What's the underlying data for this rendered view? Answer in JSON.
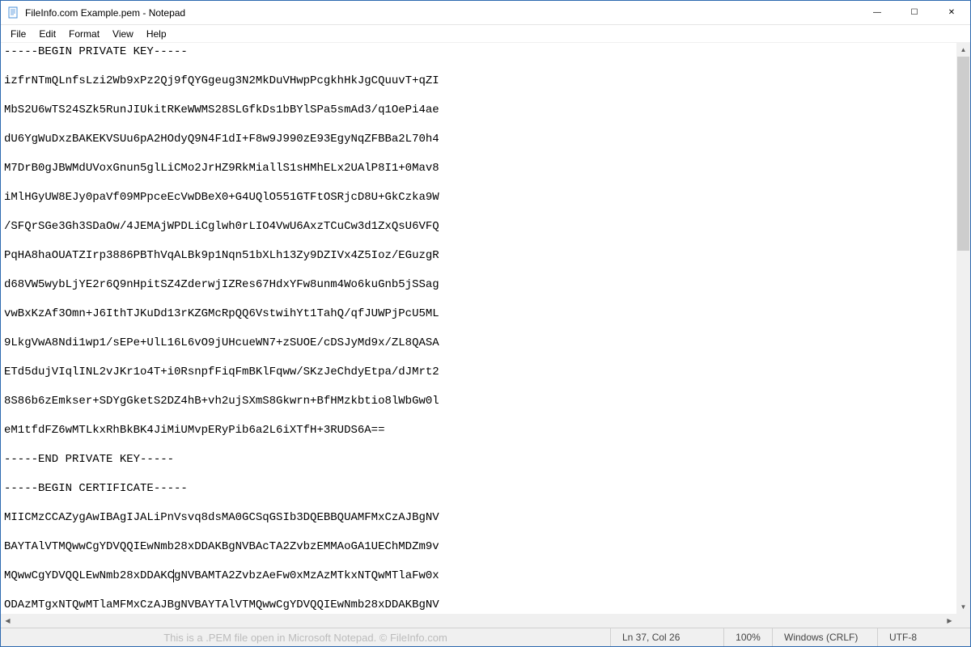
{
  "titlebar": {
    "icon_glyph": "📄",
    "title": "FileInfo.com Example.pem - Notepad"
  },
  "win_controls": {
    "minimize": "—",
    "maximize": "☐",
    "close": "✕"
  },
  "menu": {
    "file": "File",
    "edit": "Edit",
    "format": "Format",
    "view": "View",
    "help": "Help"
  },
  "editor": {
    "content": "-----BEGIN PRIVATE KEY-----\n\nizfrNTmQLnfsLzi2Wb9xPz2Qj9fQYGgeug3N2MkDuVHwpPcgkhHkJgCQuuvT+qZI\n\nMbS2U6wTS24SZk5RunJIUkitRKeWWMS28SLGfkDs1bBYlSPa5smAd3/q1OePi4ae\n\ndU6YgWuDxzBAKEKVSUu6pA2HOdyQ9N4F1dI+F8w9J990zE93EgyNqZFBBa2L70h4\n\nM7DrB0gJBWMdUVoxGnun5glLiCMo2JrHZ9RkMiallS1sHMhELx2UAlP8I1+0Mav8\n\niMlHGyUW8EJy0paVf09MPpceEcVwDBeX0+G4UQlO551GTFtOSRjcD8U+GkCzka9W\n\n/SFQrSGe3Gh3SDaOw/4JEMAjWPDLiCglwh0rLIO4VwU6AxzTCuCw3d1ZxQsU6VFQ\n\nPqHA8haOUATZIrp3886PBThVqALBk9p1Nqn51bXLh13Zy9DZIVx4Z5Ioz/EGuzgR\n\nd68VW5wybLjYE2r6Q9nHpitSZ4ZderwjIZRes67HdxYFw8unm4Wo6kuGnb5jSSag\n\nvwBxKzAf3Omn+J6IthTJKuDd13rKZGMcRpQQ6VstwihYt1TahQ/qfJUWPjPcU5ML\n\n9LkgVwA8Ndi1wp1/sEPe+UlL16L6vO9jUHcueWN7+zSUOE/cDSJyMd9x/ZL8QASA\n\nETd5dujVIqlINL2vJKr1o4T+i0RsnpfFiqFmBKlFqww/SKzJeChdyEtpa/dJMrt2\n\n8S86b6zEmkser+SDYgGketS2DZ4hB+vh2ujSXmS8Gkwrn+BfHMzkbtio8lWbGw0l\n\neM1tfdFZ6wMTLkxRhBkBK4JiMiUMvpERyPib6a2L6iXTfH+3RUDS6A==\n\n-----END PRIVATE KEY-----\n\n-----BEGIN CERTIFICATE-----\n\nMIICMzCCAZygAwIBAgIJALiPnVsvq8dsMA0GCSqGSIb3DQEBBQUAMFMxCzAJBgNV\n\nBAYTAlVTMQwwCgYDVQQIEwNmb28xDDAKBgNVBAcTA2ZvbzEMMAoGA1UEChMDZm9v\n\nMQwwCgYDVQQLEwNmb28xDDAKCgNVBAMTA2ZvbzAeFw0xMzAzMTkxNTQwMTlaFw0x\n\nODAzMTgxNTQwMTlaMFMxCzAJBgNVBAYTAlVTMQwwCgYDVQQIEwNmb28xDDAKBgNV"
  },
  "scroll": {
    "up": "▲",
    "down": "▼",
    "left": "◀",
    "right": "▶"
  },
  "status": {
    "watermark": "This is a .PEM file open in Microsoft Notepad. © FileInfo.com",
    "position": "Ln 37, Col 26",
    "zoom": "100%",
    "eol": "Windows (CRLF)",
    "encoding": "UTF-8"
  }
}
